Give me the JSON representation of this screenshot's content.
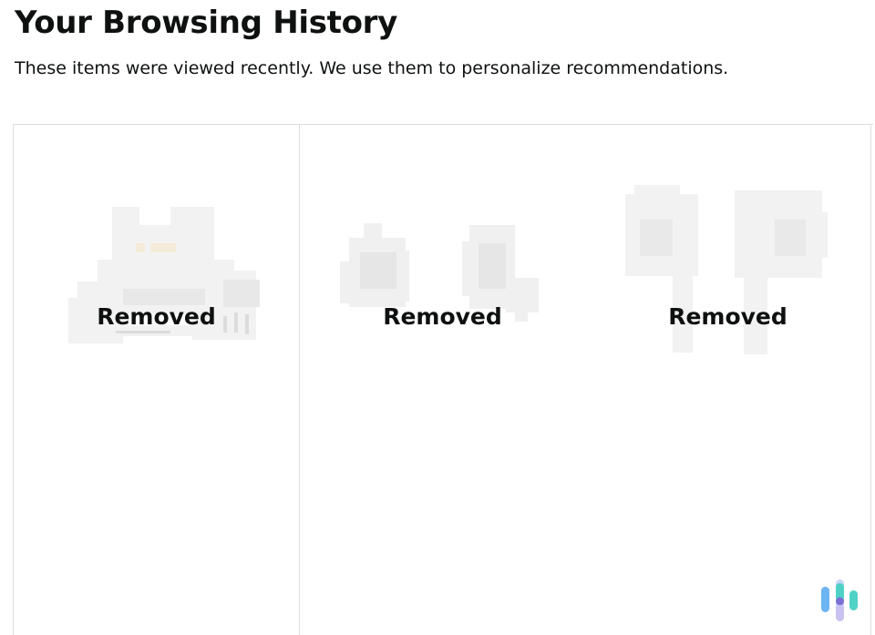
{
  "header": {
    "title": "Your Browsing History",
    "subtitle": "These items were viewed recently. We use them to personalize recommendations."
  },
  "items": [
    {
      "status_label": "Removed",
      "image_icon": "blurred-product-thumbnail-cable-adapter"
    },
    {
      "status_label": "Removed",
      "image_icon": "blurred-product-thumbnail-earbuds"
    },
    {
      "status_label": "Removed",
      "image_icon": "blurred-product-thumbnail-airpods"
    }
  ],
  "watermark": {
    "icon": "bars-logo-icon",
    "colors": [
      "#6cb4f2",
      "#4fd1c5",
      "#7b6fd6"
    ]
  }
}
